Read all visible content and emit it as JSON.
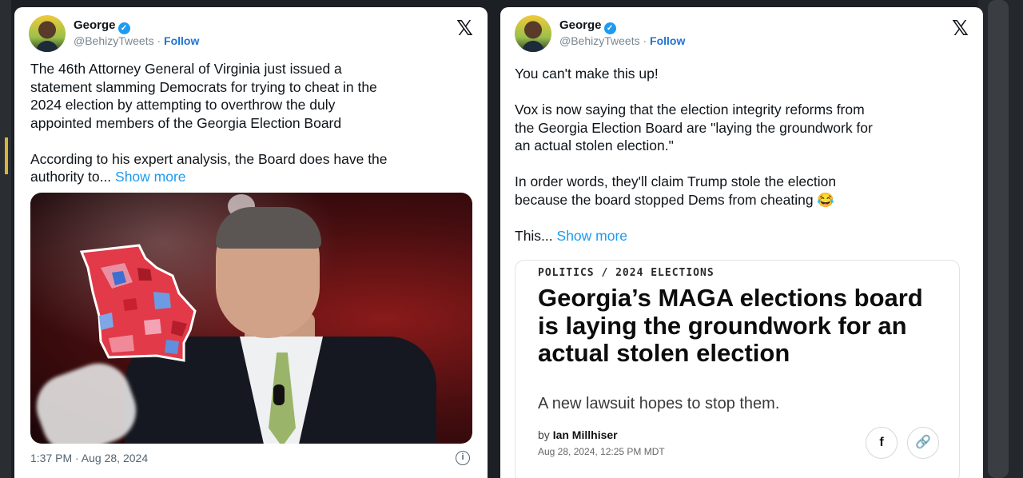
{
  "tweets": [
    {
      "name": "George",
      "handle": "@BehizyTweets",
      "follow_label": "Follow",
      "separator": " · ",
      "text": "The 46th Attorney General of Virginia just issued a\nstatement slamming Democrats for trying to cheat in the\n2024 election by attempting to overthrow the duly\nappointed members of the Georgia Election Board\n\nAccording to his expert analysis, the Board does have the\nauthority to... ",
      "show_more": "Show more",
      "timestamp": "1:37 PM · Aug 28, 2024"
    },
    {
      "name": "George",
      "handle": "@BehizyTweets",
      "follow_label": "Follow",
      "separator": " · ",
      "text": "You can't make this up!\n\nVox is now saying that the election integrity reforms from\nthe Georgia Election Board are \"laying the groundwork for\nan actual stolen election.\"\n\nIn order words, they'll claim Trump stole the election\nbecause the board stopped Dems from cheating 😂\n\nThis... ",
      "show_more": "Show more",
      "article": {
        "kicker": "POLITICS / 2024 ELECTIONS",
        "headline": "Georgia’s MAGA elections board is laying the groundwork for an actual stolen election",
        "dek": "A new lawsuit hopes to stop them.",
        "by_prefix": "by ",
        "author": "Ian Millhiser",
        "date": "Aug 28, 2024, 12:25 PM MDT",
        "share_facebook": "f",
        "share_link": "🔗"
      }
    }
  ],
  "icons": {
    "verified": "✓",
    "x_logo": "𝕏",
    "info": "i"
  },
  "colors": {
    "follow": "#1d74d4",
    "show_more": "#1d9bf0",
    "verified": "#1d9bf0"
  }
}
